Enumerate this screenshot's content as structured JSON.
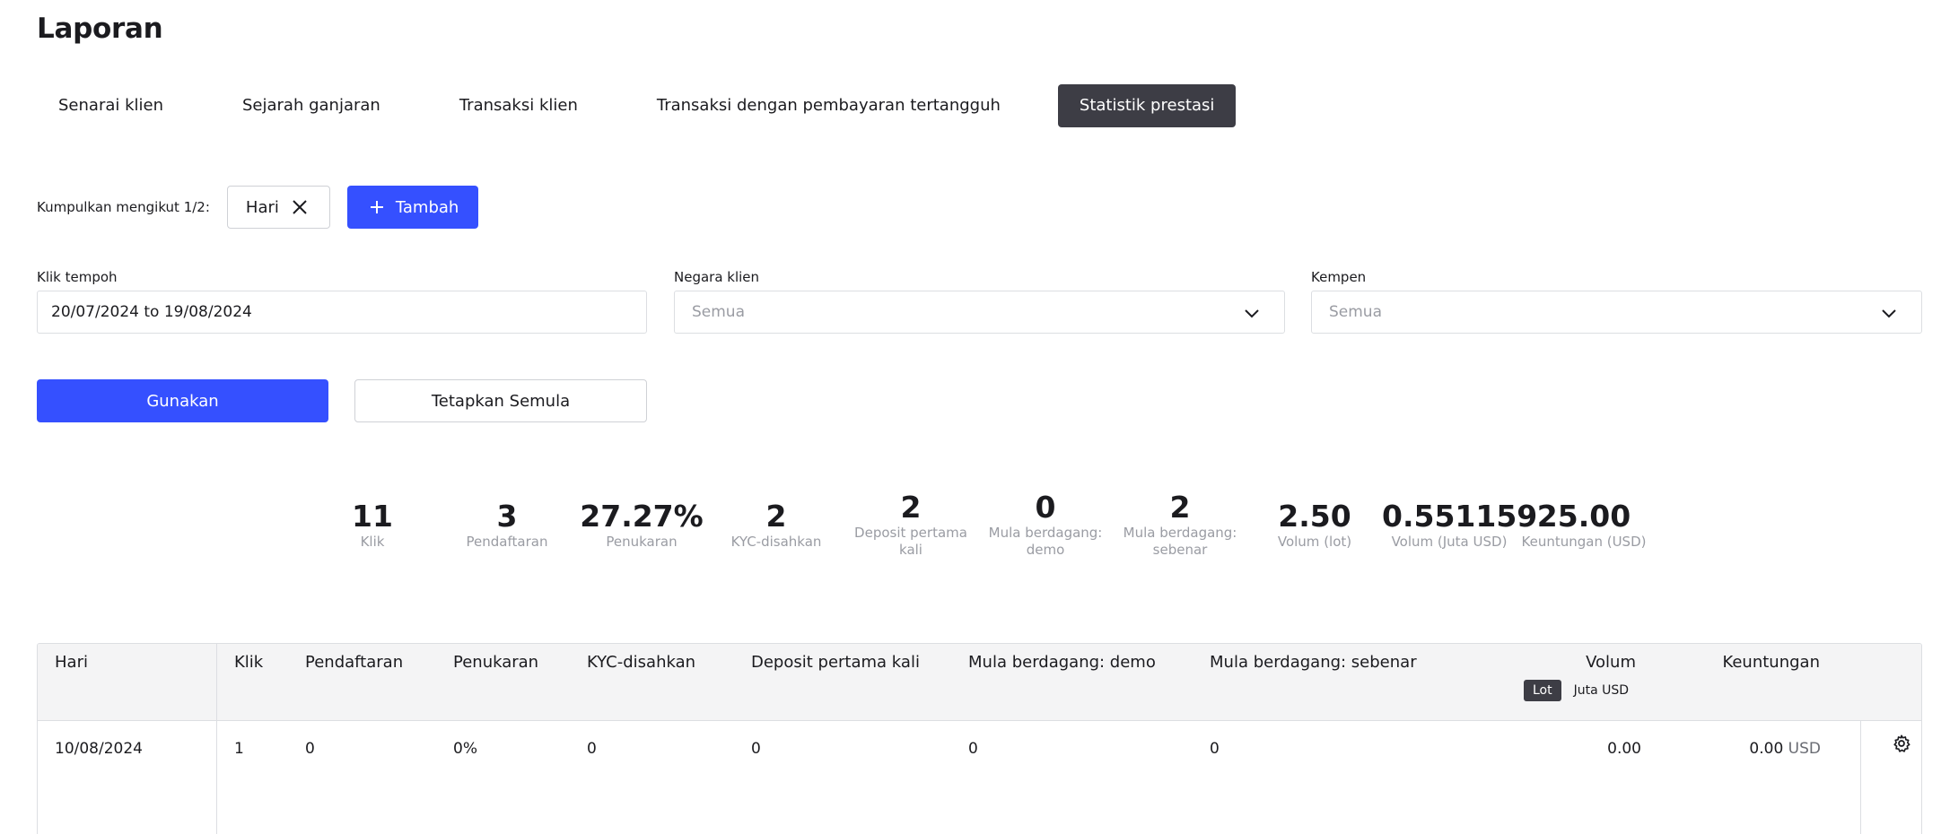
{
  "page": {
    "title": "Laporan"
  },
  "tabs": [
    {
      "label": "Senarai klien"
    },
    {
      "label": "Sejarah ganjaran"
    },
    {
      "label": "Transaksi klien"
    },
    {
      "label": "Transaksi dengan pembayaran tertangguh"
    },
    {
      "label": "Statistik prestasi",
      "active": true
    }
  ],
  "grouping": {
    "label": "Kumpulkan mengikut 1/2:",
    "chip": "Hari",
    "add_label": "Tambah"
  },
  "filters": {
    "period_label": "Klik tempoh",
    "period_value": "20/07/2024 to 19/08/2024",
    "country_label": "Negara klien",
    "country_placeholder": "Semua",
    "campaign_label": "Kempen",
    "campaign_placeholder": "Semua"
  },
  "actions": {
    "apply": "Gunakan",
    "reset": "Tetapkan Semula"
  },
  "stats": [
    {
      "value": "11",
      "label": "Klik"
    },
    {
      "value": "3",
      "label": "Pendaftaran"
    },
    {
      "value": "27.27%",
      "label": "Penukaran"
    },
    {
      "value": "2",
      "label": "KYC-disahkan"
    },
    {
      "value": "2",
      "label": "Deposit pertama kali"
    },
    {
      "value": "0",
      "label": "Mula berdagang: demo"
    },
    {
      "value": "2",
      "label": "Mula berdagang: sebenar"
    },
    {
      "value": "2.50",
      "label": "Volum (lot)"
    },
    {
      "value": "0.551159",
      "label": "Volum (Juta USD)"
    },
    {
      "value": "25.00",
      "label": "Keuntungan (USD)"
    }
  ],
  "table": {
    "headers": {
      "day": "Hari",
      "clicks": "Klik",
      "registrations": "Pendaftaran",
      "conversion": "Penukaran",
      "kyc": "KYC-disahkan",
      "first_deposit": "Deposit pertama kali",
      "demo": "Mula berdagang: demo",
      "real": "Mula berdagang: sebenar",
      "volume": "Volum",
      "profit": "Keuntungan"
    },
    "volume_units": {
      "active": "Lot",
      "alt": "Juta USD"
    },
    "rows": [
      {
        "day": "10/08/2024",
        "clicks": "1",
        "registrations": "0",
        "conversion": "0%",
        "kyc": "0",
        "first_deposit": "0",
        "demo": "0",
        "real": "0",
        "volume": "0.00",
        "profit": "0.00",
        "profit_unit": "USD"
      }
    ]
  },
  "colors": {
    "primary": "#3550ff",
    "dark": "#3d3d45",
    "muted": "#9a9ca3"
  },
  "icons": {
    "remove_chip": "close-icon",
    "add": "plus-icon",
    "dropdown": "chevron-down-icon",
    "settings": "gear-icon"
  }
}
